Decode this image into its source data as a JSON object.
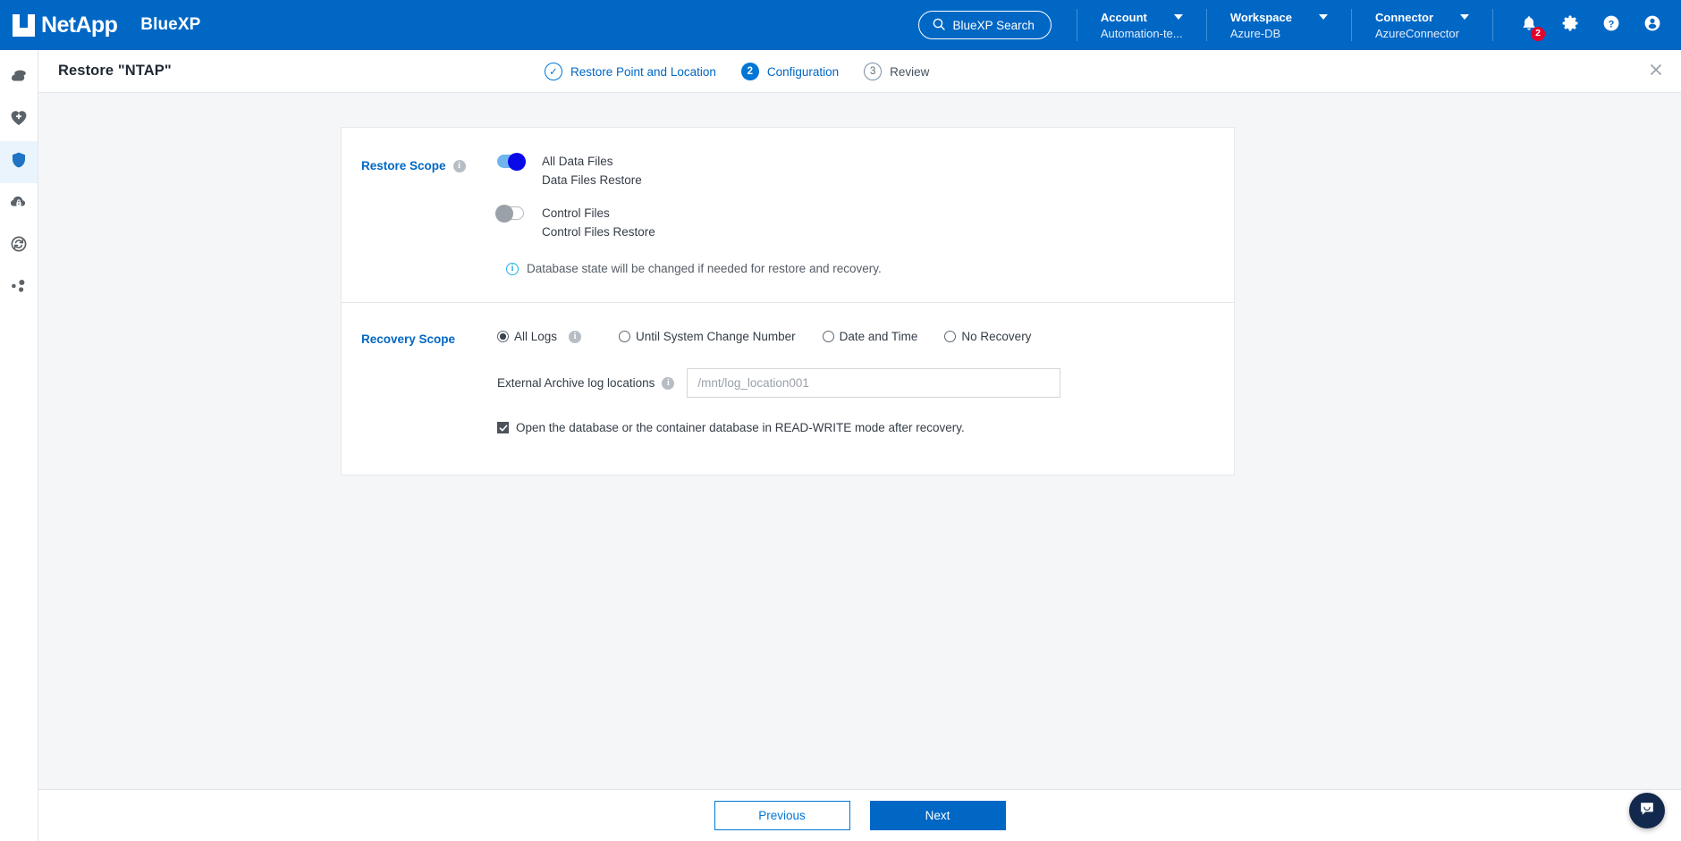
{
  "header": {
    "brand_netapp": "NetApp",
    "brand_product": "BlueXP",
    "search_label": "BlueXP Search",
    "selectors": [
      {
        "label": "Account",
        "value": "Automation-te..."
      },
      {
        "label": "Workspace",
        "value": "Azure-DB"
      },
      {
        "label": "Connector",
        "value": "AzureConnector"
      }
    ],
    "notification_count": "2",
    "icons": [
      "bell-icon",
      "gear-icon",
      "help-icon",
      "user-avatar-icon"
    ]
  },
  "sidebar": {
    "items": [
      {
        "name": "canvas-icon",
        "active": false
      },
      {
        "name": "health-icon",
        "active": false
      },
      {
        "name": "protection-shield-icon",
        "active": true
      },
      {
        "name": "governance-cloud-lock-icon",
        "active": false
      },
      {
        "name": "mobility-sync-icon",
        "active": false
      },
      {
        "name": "extensions-nodes-icon",
        "active": false
      }
    ]
  },
  "page": {
    "title": "Restore \"NTAP\"",
    "close_label": "×",
    "steps": [
      {
        "marker": "✓",
        "label": "Restore Point and Location",
        "state": "done"
      },
      {
        "marker": "2",
        "label": "Configuration",
        "state": "current"
      },
      {
        "marker": "3",
        "label": "Review",
        "state": "todo"
      }
    ]
  },
  "restore_scope": {
    "label": "Restore Scope",
    "info": "i",
    "toggles": [
      {
        "title": "All Data Files",
        "subtitle": "Data Files Restore",
        "on": true
      },
      {
        "title": "Control Files",
        "subtitle": "Control Files Restore",
        "on": false
      }
    ],
    "note_icon": "i",
    "note": "Database state will be changed if needed for restore and recovery."
  },
  "recovery_scope": {
    "label": "Recovery Scope",
    "options": [
      {
        "label": "All Logs",
        "checked": true,
        "has_info": true
      },
      {
        "label": "Until System Change Number",
        "checked": false,
        "has_info": false
      },
      {
        "label": "Date and Time",
        "checked": false,
        "has_info": false
      },
      {
        "label": "No Recovery",
        "checked": false,
        "has_info": false
      }
    ],
    "info": "i",
    "archive_label": "External Archive log locations",
    "archive_placeholder": "/mnt/log_location001",
    "archive_value": "",
    "checkbox_checked": true,
    "checkbox_label": "Open the database or the container database in READ-WRITE mode after recovery."
  },
  "footer": {
    "previous_label": "Previous",
    "next_label": "Next"
  },
  "chat": {
    "name": "chat-bubble-icon"
  },
  "colors": {
    "brand_blue": "#0067c5",
    "accent_blue": "#0076d6",
    "toggle_on_knob": "#0a0ae8",
    "toggle_on_track": "#6fb4ef",
    "info_cyan": "#21b2e4",
    "badge_red": "#e4002b",
    "page_bg": "#f5f6f7",
    "chat_navy": "#12284c"
  }
}
